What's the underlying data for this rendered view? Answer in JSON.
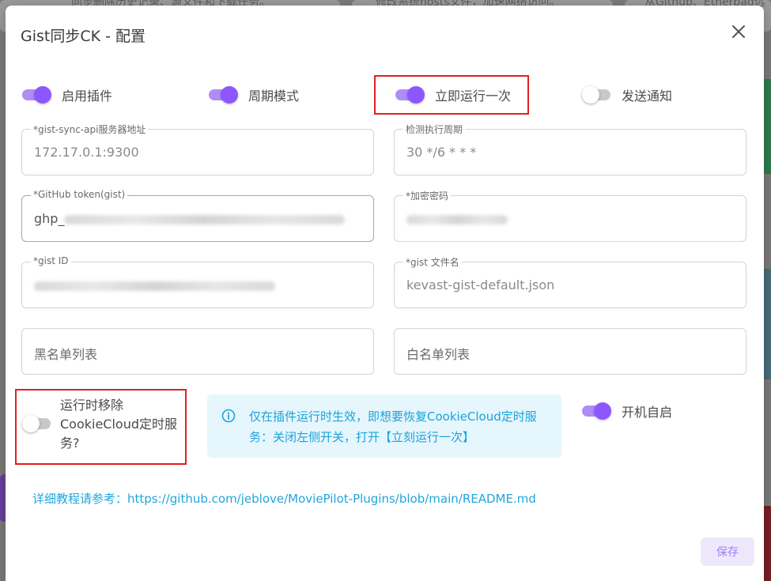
{
  "background": {
    "snippets": [
      "同步删除历史记录、源文件和下载任务。",
      "修改系统hosts文件，加速网络访问。",
      "从Github、Etherpad远"
    ]
  },
  "dialog": {
    "title": "Gist同步CK - 配置",
    "close_label": "×"
  },
  "switches": {
    "enable_plugin": {
      "label": "启用插件",
      "on": true
    },
    "cron_mode": {
      "label": "周期模式",
      "on": true
    },
    "run_once": {
      "label": "立即运行一次",
      "on": true
    },
    "notify": {
      "label": "发送通知",
      "on": false
    },
    "remove_on_run": {
      "label": "运行时移除CookieCloud定时服务?",
      "on": false
    },
    "autostart": {
      "label": "开机自启",
      "on": true
    }
  },
  "fields": {
    "api_server": {
      "label": "*gist-sync-api服务器地址",
      "value": "172.17.0.1:9300"
    },
    "cron": {
      "label": "检测执行周期",
      "value": "30 */6 * * *"
    },
    "github_token": {
      "label": "*GitHub token(gist)",
      "value": "ghp_"
    },
    "encrypt_password": {
      "label": "*加密密码",
      "value": ""
    },
    "gist_id": {
      "label": "*gist ID",
      "value": ""
    },
    "gist_filename": {
      "label": "*gist 文件名",
      "value": "kevast-gist-default.json"
    },
    "blacklist": {
      "placeholder": "黑名单列表"
    },
    "whitelist": {
      "placeholder": "白名单列表"
    }
  },
  "alert": {
    "text": "仅在插件运行时生效，即想要恢复CookieCloud定时服务：关闭左侧开关，打开【立刻运行一次】",
    "color": "#1aa3d9",
    "background": "#e6f6fd"
  },
  "tutorial": {
    "text": "详细教程请参考：https://github.com/jeblove/MoviePilot-Plugins/blob/main/README.md"
  },
  "actions": {
    "save_label": "保存"
  },
  "colors": {
    "accent": "#8c57ff",
    "highlight": "#e02020"
  }
}
